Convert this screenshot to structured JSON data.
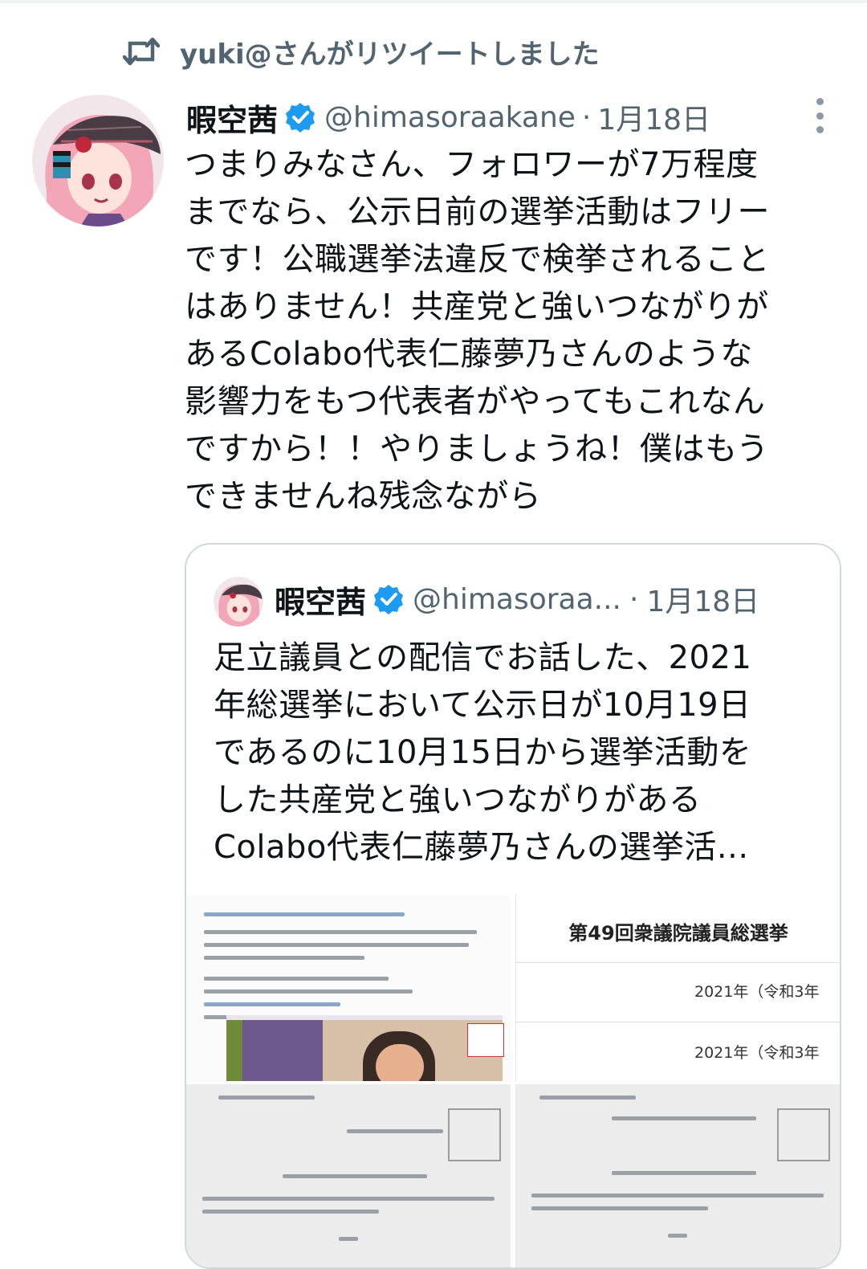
{
  "retweet": {
    "text": "yuki@さんがリツイートしました",
    "icon": "retweet-icon"
  },
  "tweet": {
    "author_name": "暇空茜",
    "handle": "@himasoraakane",
    "separator": "·",
    "date": "1月18日",
    "verified_color": "#1d9bf0",
    "lines": [
      "つまりみなさん、フォロワーが7万程度",
      "までなら、公示日前の選挙活動はフリー",
      "です！公職選挙法違反で検挙されること",
      "はありません！共産党と強いつながりが",
      "あるColabo代表仁藤夢乃さんのような",
      "影響力をもつ代表者がやってもこれなん",
      "ですから！！やりましょうね！僕はもう",
      "できませんね残念ながら"
    ]
  },
  "quote": {
    "author_name": "暇空茜",
    "handle": "@himasoraa...",
    "separator": "·",
    "date": "1月18日",
    "lines": [
      "足立議員との配信でお話した、2021",
      "年総選挙において公示日が10月19日",
      "であるのに10月15日から選挙活動を",
      "した共産党と強いつながりがある",
      "Colabo代表仁藤夢乃さんの選挙活..."
    ],
    "media": {
      "doc_title": "第49回衆議院議員総選挙",
      "doc_row_1": "2021年（令和3年",
      "doc_row_2": "2021年（令和3年"
    }
  }
}
